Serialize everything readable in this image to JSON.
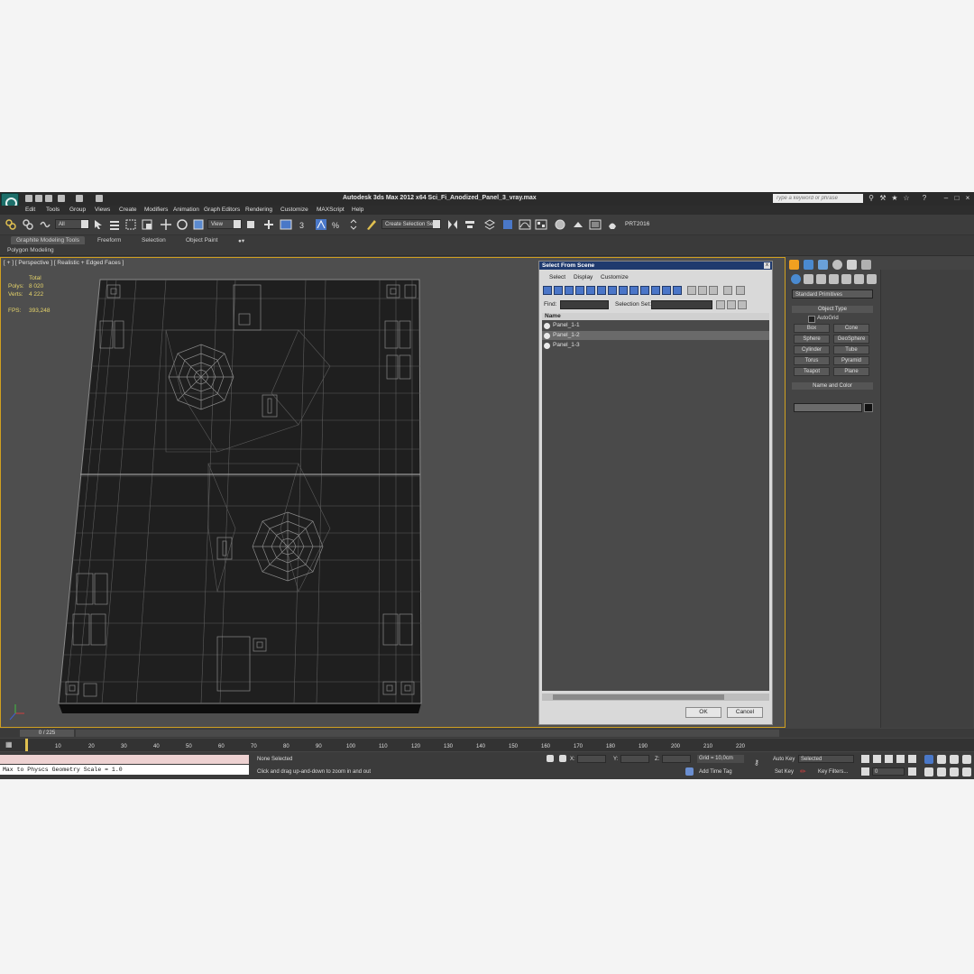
{
  "window": {
    "title": "Autodesk 3ds Max  2012 x64    Sci_Fi_Anodized_Panel_3_vray.max",
    "search_placeholder": "Type a keyword or phrase"
  },
  "menu": [
    "Edit",
    "Tools",
    "Group",
    "Views",
    "Create",
    "Modifiers",
    "Animation",
    "Graph Editors",
    "Rendering",
    "Customize",
    "MAXScript",
    "Help"
  ],
  "toolbar": {
    "filter_select": "All",
    "ref_coord_select": "View",
    "named_selection": "Create Selection Se",
    "prt_label": "PRT2016"
  },
  "ribbon": {
    "tabs": [
      "Graphite Modeling Tools",
      "Freeform",
      "Selection",
      "Object Paint"
    ],
    "subtab": "Polygon Modeling"
  },
  "viewport": {
    "label": "[ + ] [ Perspective ] [ Realistic + Edged Faces ]",
    "stats": {
      "total_label": "Total",
      "polys_label": "Polys:",
      "polys_value": "8 020",
      "verts_label": "Verts:",
      "verts_value": "4 222",
      "fps_label": "FPS:",
      "fps_value": "393,248"
    }
  },
  "dialog": {
    "title": "Select From Scene",
    "close": "x",
    "menu": [
      "Select",
      "Display",
      "Customize"
    ],
    "find_label": "Find:",
    "selection_set_label": "Selection Set:",
    "list_header": "Name",
    "items": [
      "Panel_1-1",
      "Panel_1-2",
      "Panel_1-3"
    ],
    "ok": "OK",
    "cancel": "Cancel"
  },
  "command_panel": {
    "category": "Standard Primitives",
    "object_type_header": "Object Type",
    "autogrid": "AutoGrid",
    "buttons": [
      "Box",
      "Cone",
      "Sphere",
      "GeoSphere",
      "Cylinder",
      "Tube",
      "Torus",
      "Pyramid",
      "Teapot",
      "Plane"
    ],
    "name_color_header": "Name and Color"
  },
  "timeline": {
    "slider": "0 / 225",
    "ticks": [
      "10",
      "20",
      "30",
      "40",
      "50",
      "60",
      "70",
      "80",
      "90",
      "100",
      "110",
      "120",
      "130",
      "140",
      "150",
      "160",
      "170",
      "180",
      "190",
      "200",
      "210",
      "220"
    ]
  },
  "status": {
    "maxscript_output": "Max to Physcs Geometry Scale = 1.0",
    "selection": "None Selected",
    "prompt": "Click and drag up-and-down to zoom in and out",
    "x_label": "X:",
    "y_label": "Y:",
    "z_label": "Z:",
    "grid": "Grid = 10,0cm",
    "add_time_tag": "Add Time Tag",
    "auto_key": "Auto Key",
    "set_key": "Set Key",
    "key_mode": "Selected",
    "key_filters": "Key Filters...",
    "frame": "0"
  }
}
